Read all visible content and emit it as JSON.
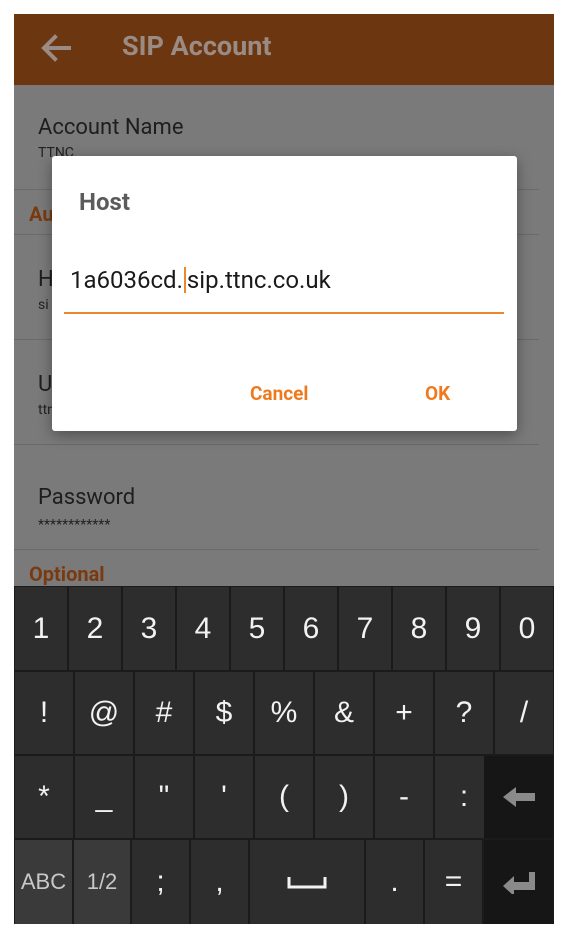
{
  "appbar": {
    "title": "SIP Account",
    "back_icon": "arrow-left-icon"
  },
  "settings": {
    "account_name_label": "Account Name",
    "account_name_value": "TTNC",
    "section_authentication": "Au",
    "host_label": "H",
    "host_summary": "si",
    "username_label": "U",
    "username_summary": "ttn",
    "password_label": "Password",
    "password_value": "************",
    "section_optional": "Optional"
  },
  "dialog": {
    "title": "Host",
    "input_before_caret": "1a6036cd.",
    "input_after_caret": "sip.ttnc.co.uk",
    "cancel_label": "Cancel",
    "ok_label": "OK"
  },
  "keyboard": {
    "row1": [
      "1",
      "2",
      "3",
      "4",
      "5",
      "6",
      "7",
      "8",
      "9",
      "0"
    ],
    "row2": [
      "!",
      "@",
      "#",
      "$",
      "%",
      "&",
      "+",
      "?",
      "/"
    ],
    "row3": [
      "*",
      "_",
      "\"",
      "'",
      "(",
      ")",
      "-",
      ":"
    ],
    "row4_abc": "ABC",
    "row4_page": "1/2",
    "row4_keys": [
      ";",
      ",",
      "."
    ],
    "row4_equals": "="
  },
  "colors": {
    "appbar": "#6b3610",
    "accent": "#ef7a1e",
    "keyboard_bg": "#1b1b1b",
    "key_bg": "#2d2d2d"
  }
}
